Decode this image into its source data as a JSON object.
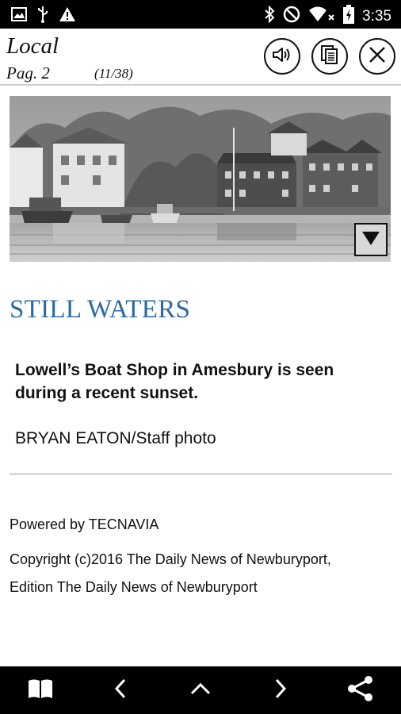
{
  "status_bar": {
    "time": "3:35",
    "left_icons": [
      "image-icon",
      "usb-icon",
      "warning-icon"
    ],
    "right_icons": [
      "bluetooth-icon",
      "do-not-disturb-icon",
      "wifi-icon",
      "battery-charging-icon"
    ]
  },
  "header": {
    "section": "Local",
    "page_label": "Pag. 2",
    "page_count": "(11/38)",
    "buttons": [
      "speaker-icon",
      "pages-icon",
      "close-icon"
    ]
  },
  "article": {
    "headline": "STILL WATERS",
    "caption": "Lowell’s Boat Shop in Amesbury is seen during a recent sunset.",
    "credit": "BRYAN EATON/Staff photo"
  },
  "footer": {
    "powered": "Powered by TECNAVIA",
    "copyright": "Copyright (c)2016 The Daily News of Newburyport, Edition The Daily News of Newburyport"
  },
  "bottom_nav": [
    "book-icon",
    "back-icon",
    "up-icon",
    "forward-icon",
    "share-icon"
  ],
  "colors": {
    "headline": "#2a6aa3",
    "bars": "#000000"
  }
}
